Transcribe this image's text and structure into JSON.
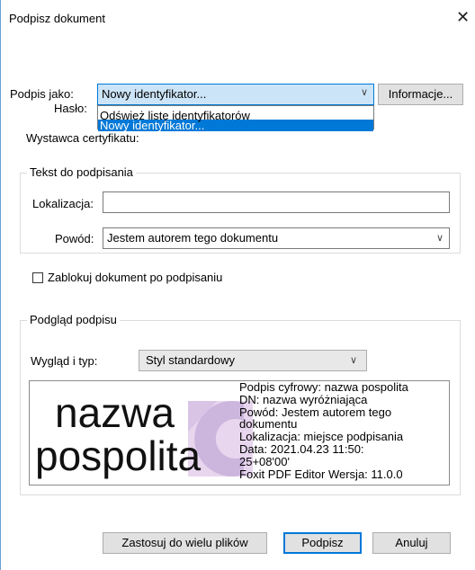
{
  "dialog": {
    "title": "Podpisz dokument"
  },
  "sign_as": {
    "label": "Podpis jako:",
    "value": "Nowy identyfikator...",
    "info_button": "Informacje...",
    "dropdown_items": [
      "Odśwież listę identyfikatorów",
      "Nowy identyfikator..."
    ]
  },
  "password": {
    "label": "Hasło:"
  },
  "issuer": {
    "label": "Wystawca certyfikatu:"
  },
  "text_to_sign": {
    "group_label": "Tekst do podpisania",
    "location_label": "Lokalizacja:",
    "location_value": "",
    "reason_label": "Powód:",
    "reason_value": "Jestem autorem tego dokumentu"
  },
  "lock": {
    "label": "Zablokuj dokument po podpisaniu",
    "checked": false
  },
  "preview": {
    "group_label": "Podgląd podpisu",
    "appearance_label": "Wygląd i typ:",
    "appearance_value": "Styl standardowy",
    "name_line1": "nazwa",
    "name_line2": "pospolita",
    "details": [
      "Podpis cyfrowy: nazwa pospolita",
      "DN: nazwa wyróżniająca",
      "Powód: Jestem autorem tego",
      "dokumentu",
      "Lokalizacja: miejsce podpisania",
      "Data: 2021.04.23 11:50:",
      "25+08'00'",
      "Foxit PDF Editor Wersja: 11.0.0"
    ]
  },
  "buttons": {
    "apply_multiple": "Zastosuj do wielu plików",
    "sign": "Podpisz",
    "cancel": "Anuluj"
  },
  "icons": {
    "close": "close-icon",
    "chevron": "chevron-down-icon",
    "watermark": "foxit-logo-watermark"
  },
  "colors": {
    "accent": "#0078d7",
    "selection_bg": "#cce4f7",
    "watermark": "#cdb6dd"
  }
}
